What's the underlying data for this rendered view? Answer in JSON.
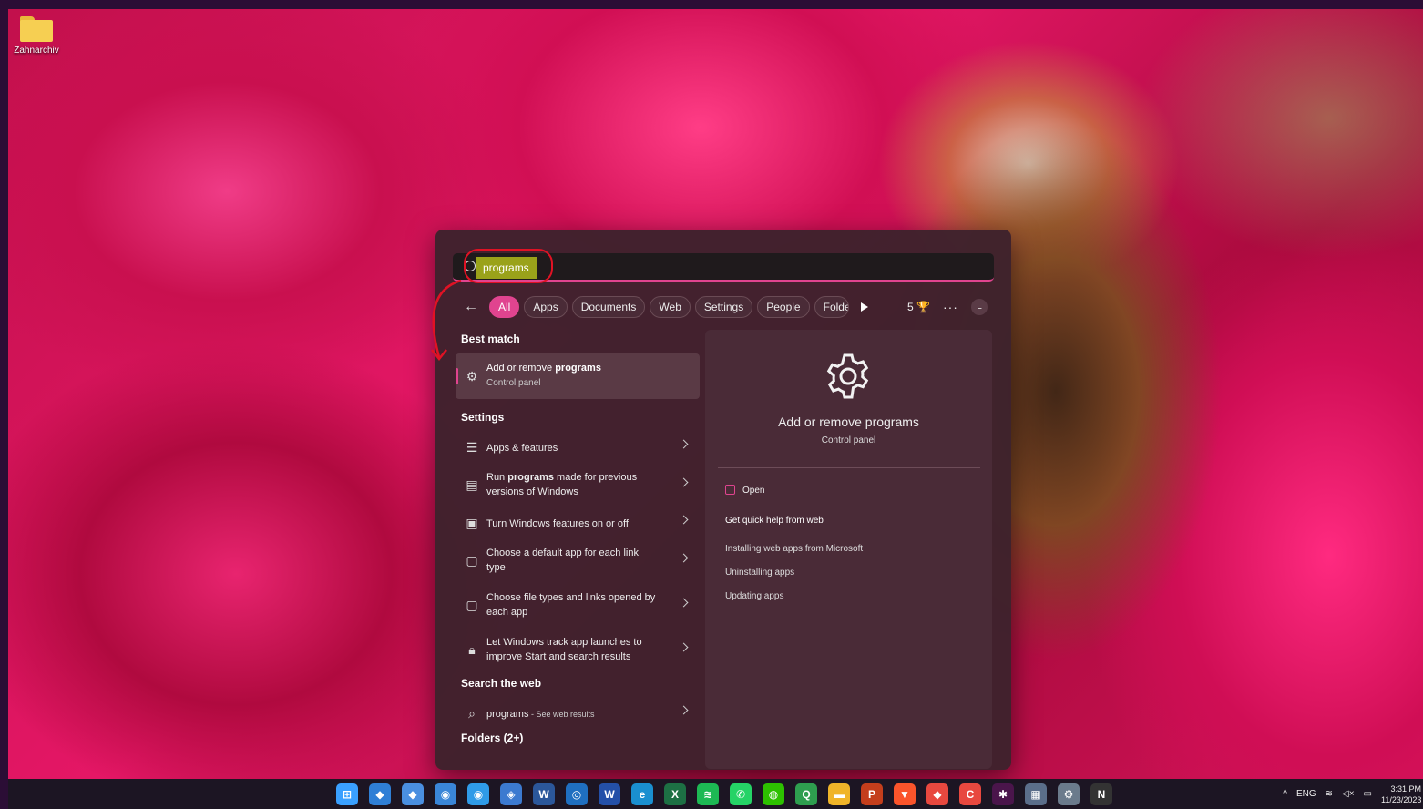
{
  "desktop": {
    "icon_label": "Zahnarchiv"
  },
  "search": {
    "query": "programs"
  },
  "filters": {
    "chips": [
      "All",
      "Apps",
      "Documents",
      "Web",
      "Settings",
      "People",
      "Folders"
    ],
    "points": "5",
    "avatar": "L",
    "more": "···"
  },
  "best_match": {
    "heading": "Best match",
    "title_prefix": "Add or remove ",
    "title_bold": "programs",
    "subtitle": "Control panel"
  },
  "settings": {
    "heading": "Settings",
    "items": [
      {
        "pre": "Apps & features",
        "bold": "",
        "post": ""
      },
      {
        "pre": "Run ",
        "bold": "programs",
        "post": " made for previous versions of Windows"
      },
      {
        "pre": "Turn Windows features on or off",
        "bold": "",
        "post": ""
      },
      {
        "pre": "Choose a default app for each link type",
        "bold": "",
        "post": ""
      },
      {
        "pre": "Choose file types and links opened by each app",
        "bold": "",
        "post": ""
      },
      {
        "pre": "Let Windows track app launches to improve Start and search results",
        "bold": "",
        "post": ""
      }
    ]
  },
  "web": {
    "heading": "Search the web",
    "query": "programs",
    "suffix": " - See web results"
  },
  "folders": {
    "heading": "Folders (2+)"
  },
  "preview": {
    "title": "Add or remove programs",
    "subtitle": "Control panel",
    "open": "Open",
    "quick_help": "Get quick help from web",
    "links": [
      "Installing web apps from Microsoft",
      "Uninstalling apps",
      "Updating apps"
    ]
  },
  "taskbar": {
    "apps": [
      {
        "name": "start",
        "glyph": "⊞",
        "color": "#3aa0ff"
      },
      {
        "name": "app-1",
        "glyph": "◆",
        "color": "#2f7fd6"
      },
      {
        "name": "app-2",
        "glyph": "◆",
        "color": "#4a8fe0"
      },
      {
        "name": "app-3",
        "glyph": "◉",
        "color": "#3a86d8"
      },
      {
        "name": "app-4",
        "glyph": "◉",
        "color": "#2f9be8"
      },
      {
        "name": "app-5",
        "glyph": "◈",
        "color": "#3c7ad0"
      },
      {
        "name": "word",
        "glyph": "W",
        "color": "#2b579a"
      },
      {
        "name": "app-7",
        "glyph": "◎",
        "color": "#1f6fc0"
      },
      {
        "name": "app-8",
        "glyph": "W",
        "color": "#2450a8"
      },
      {
        "name": "edge",
        "glyph": "e",
        "color": "#1a8fd0"
      },
      {
        "name": "excel",
        "glyph": "X",
        "color": "#1d7044"
      },
      {
        "name": "spotify",
        "glyph": "≋",
        "color": "#1db954"
      },
      {
        "name": "whatsapp",
        "glyph": "✆",
        "color": "#25d366"
      },
      {
        "name": "wechat",
        "glyph": "◍",
        "color": "#2dc100"
      },
      {
        "name": "app-14",
        "glyph": "Q",
        "color": "#2e9e4f"
      },
      {
        "name": "explorer",
        "glyph": "▬",
        "color": "#f0b429"
      },
      {
        "name": "powerpoint",
        "glyph": "P",
        "color": "#c43e1c"
      },
      {
        "name": "brave",
        "glyph": "▼",
        "color": "#fb542b"
      },
      {
        "name": "app-18",
        "glyph": "◆",
        "color": "#e8483f"
      },
      {
        "name": "app-19",
        "glyph": "C",
        "color": "#e8483f"
      },
      {
        "name": "slack",
        "glyph": "✱",
        "color": "#4a154b"
      },
      {
        "name": "calculator",
        "glyph": "▦",
        "color": "#5b6e8a"
      },
      {
        "name": "settings",
        "glyph": "⚙",
        "color": "#6b7b8c"
      },
      {
        "name": "notion",
        "glyph": "N",
        "color": "#333333"
      }
    ],
    "tray": {
      "chevron": "^",
      "lang": "ENG",
      "wifi": "≋",
      "sound": "◁×",
      "battery": "▭",
      "time": "3:31 PM",
      "date": "11/23/2023"
    }
  },
  "colors": {
    "accent": "#e0448f",
    "annotation": "#e01224",
    "highlight": "#9aa21a"
  }
}
